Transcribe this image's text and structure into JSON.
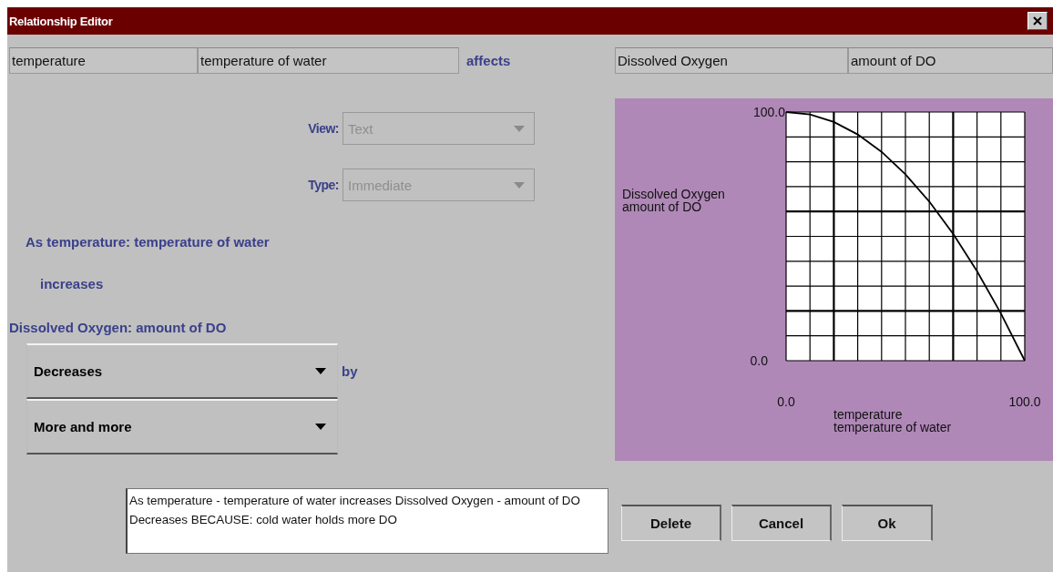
{
  "window": {
    "title": "Relationship Editor"
  },
  "cause": {
    "name": "temperature",
    "description": "temperature of water"
  },
  "relation_label": "affects",
  "effect": {
    "name": "Dissolved Oxygen",
    "description": "amount of DO"
  },
  "selectors": [
    {
      "label": "View:",
      "value": "Text",
      "disabled": true
    },
    {
      "label": "Type:",
      "value": "Immediate",
      "disabled": true
    }
  ],
  "statement": {
    "cause_line": "As temperature: temperature of water",
    "cause_change": "increases",
    "effect_line": "Dissolved Oxygen: amount of DO"
  },
  "effect_choices": [
    {
      "value": "Decreases",
      "suffix": "by",
      "disabled": false
    },
    {
      "value": "More and more",
      "disabled": false
    }
  ],
  "graph": {
    "chart_data": {
      "type": "line",
      "xlabel": [
        "temperature",
        "temperature of water"
      ],
      "ylabel": [
        "Dissolved Oxygen",
        "amount of DO"
      ],
      "x": [
        0,
        10,
        20,
        30,
        40,
        50,
        60,
        70,
        80,
        90,
        100
      ],
      "series": [
        {
          "color": "#000000",
          "values": [
            100,
            99,
            96,
            91,
            84,
            75,
            64,
            51,
            36,
            19,
            0
          ]
        }
      ],
      "xlim": [
        0,
        100
      ],
      "ylim": [
        0,
        100
      ],
      "xticks": [
        {
          "value": 0,
          "label": "0.0"
        },
        {
          "value": 100,
          "label": "100.0"
        }
      ],
      "yticks": [
        {
          "value": 0,
          "label": "0.0"
        },
        {
          "value": 100,
          "label": "100.0"
        }
      ]
    }
  },
  "summary": "As temperature - temperature of water increases Dissolved Oxygen - amount of DO Decreases BECAUSE: cold water holds more DO",
  "buttons": [
    "Delete",
    "Cancel",
    "Ok"
  ]
}
